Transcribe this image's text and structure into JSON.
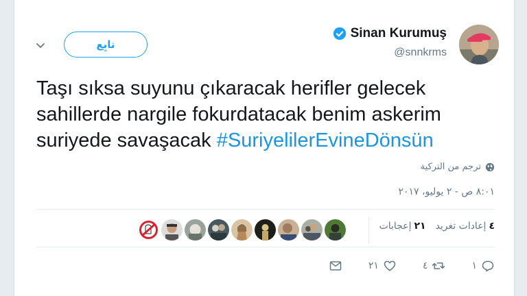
{
  "author": {
    "name": "Sinan Kurumuş",
    "handle": "@snnkrms",
    "avatar_icon": "person-with-cap-avatar",
    "verified": true
  },
  "follow_button_label": "تابِع",
  "tweet": {
    "text_plain": "Taşı sıksa suyunu çıkaracak herifler gelecek sahillerde nargile fokurdatacak benim askerim suriyede savaşacak ",
    "hashtag": "#SuriyelilerEvineDönsün"
  },
  "translate_label": "ترجم من التركية",
  "timestamp": "٨:٠١ ص - ٢ يوليو، ٢٠١٧",
  "stats": {
    "retweets_count": "٤",
    "retweets_label": "إعادات تغريد",
    "likes_count": "٢١",
    "likes_label": "إعجابات"
  },
  "actions": {
    "reply_count": "١",
    "retweet_count": "٤",
    "like_count": "٢١"
  },
  "colors": {
    "accent": "#1da1f2",
    "hashtag": "#1b95e0",
    "muted": "#657786",
    "background": "#e6ecf0"
  },
  "likers_icons": [
    "ghostbusters-avatar",
    "man-avatar",
    "photo-avatar",
    "people-avatar",
    "woman-avatar",
    "dark-figure-avatar",
    "person-avatar",
    "crowd-avatar",
    "green-avatar"
  ]
}
